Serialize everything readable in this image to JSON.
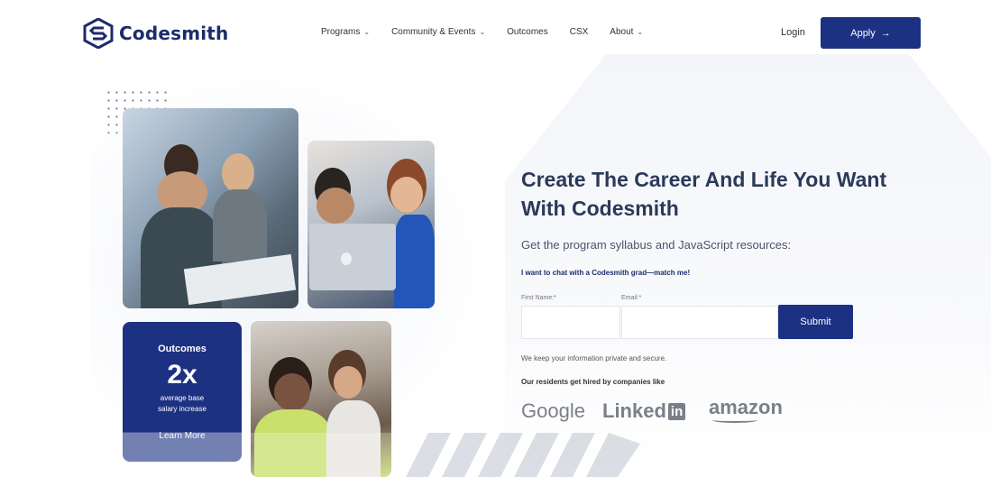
{
  "brand": {
    "name": "Codesmith"
  },
  "nav": {
    "items": [
      {
        "label": "Programs",
        "dropdown": true
      },
      {
        "label": "Community & Events",
        "dropdown": true
      },
      {
        "label": "Outcomes",
        "dropdown": false
      },
      {
        "label": "CSX",
        "dropdown": false
      },
      {
        "label": "About",
        "dropdown": true
      }
    ],
    "login": "Login",
    "apply": "Apply",
    "apply_arrow": "→"
  },
  "outcomes_card": {
    "title": "Outcomes",
    "value": "2x",
    "desc_line1": "average base",
    "desc_line2": "salary increase",
    "link": "Learn More"
  },
  "hero": {
    "headline": "Create The Career And Life You Want With Codesmith",
    "subheading": "Get the program syllabus and JavaScript resources:",
    "chat_link": "I want to chat with a Codesmith grad—match me!"
  },
  "form": {
    "first_name_label": "First Name:*",
    "email_label": "Email:*",
    "first_name_value": "",
    "email_value": "",
    "submit": "Submit",
    "privacy": "We keep your information private and secure."
  },
  "companies": {
    "heading": "Our residents get hired by companies like",
    "google": "Google",
    "linkedin_text": "Linked",
    "linkedin_box": "in",
    "amazon": "amazon"
  },
  "colors": {
    "brand_navy": "#1d3182",
    "heading": "#2b3a5a",
    "logo_gray": "#7a7f88"
  }
}
